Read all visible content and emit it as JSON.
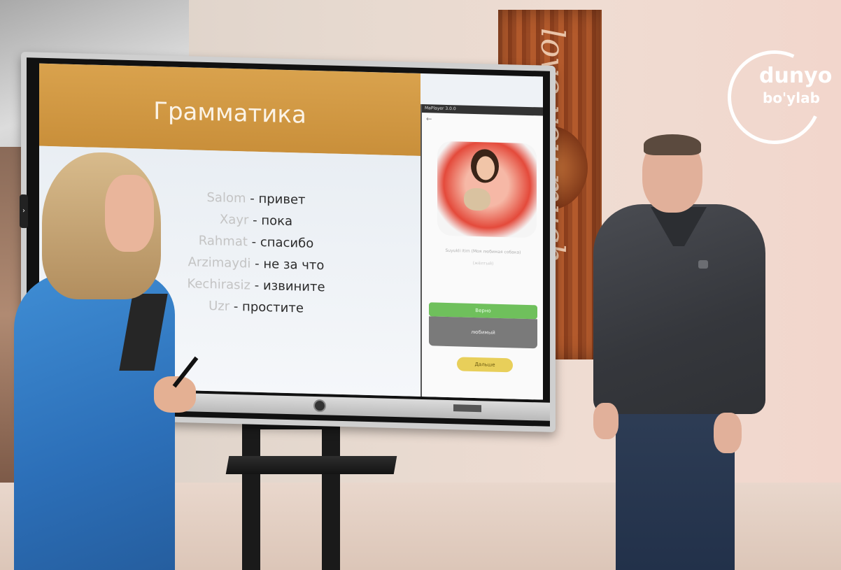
{
  "logo": {
    "line1": "dunyo",
    "line2": "bo'ylab"
  },
  "decor": {
    "wood_text": "love you much"
  },
  "slide": {
    "title": "Грамматика",
    "vocabulary": [
      {
        "uz": "Salom",
        "ru": " - привет"
      },
      {
        "uz": "Xayr",
        "ru": " - пока"
      },
      {
        "uz": "Rahmat",
        "ru": " - спасибо"
      },
      {
        "uz": "Arzimaydi",
        "ru": " - не за что"
      },
      {
        "uz": "Kechirasiz",
        "ru": " - извините"
      },
      {
        "uz": "Uzr",
        "ru": " - простите"
      }
    ]
  },
  "app": {
    "window_title": "MaPlayer 3.0.0",
    "back_icon": "arrow-left-icon",
    "caption": "Suyukli itim (Моя любимая собака)",
    "subcaption": "(жёлтый)",
    "correct_label": "Верно",
    "answer_label": "любимый",
    "next_label": "Дальше"
  },
  "colors": {
    "slide_header": "#d9a24d",
    "correct": "#6fc05c",
    "next": "#e8cf5a",
    "jacket": "#2c6fb8"
  }
}
